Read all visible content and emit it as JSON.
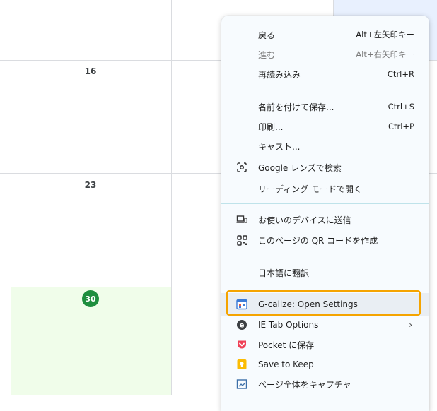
{
  "calendar": {
    "days": [
      "16",
      "23"
    ],
    "today": "30"
  },
  "menu": {
    "items": [
      {
        "label": "戻る",
        "shortcut": "Alt+左矢印キー"
      },
      {
        "label": "進む",
        "shortcut": "Alt+右矢印キー"
      },
      {
        "label": "再読み込み",
        "shortcut": "Ctrl+R"
      },
      {
        "label": "名前を付けて保存...",
        "shortcut": "Ctrl+S"
      },
      {
        "label": "印刷...",
        "shortcut": "Ctrl+P"
      },
      {
        "label": "キャスト..."
      },
      {
        "label": "Google レンズで検索",
        "icon": "google-lens-icon"
      },
      {
        "label": "リーディング モードで開く"
      },
      {
        "label": "お使いのデバイスに送信",
        "icon": "devices-icon"
      },
      {
        "label": "このページの QR コードを作成",
        "icon": "qr-code-icon"
      },
      {
        "label": "日本語に翻訳"
      },
      {
        "label": "G-calize: Open Settings",
        "icon": "gcalize-icon"
      },
      {
        "label": "IE Tab Options",
        "icon": "ie-tab-icon"
      },
      {
        "label": "Pocket に保存",
        "icon": "pocket-icon"
      },
      {
        "label": "Save to Keep",
        "icon": "keep-icon"
      },
      {
        "label": "ページ全体をキャプチャ",
        "icon": "capture-icon"
      }
    ]
  },
  "colors": {
    "today": "#1e8e3e",
    "focus": "#f5a400",
    "menu_bg": "#f7fbfe",
    "separator": "#bfe3ea"
  }
}
